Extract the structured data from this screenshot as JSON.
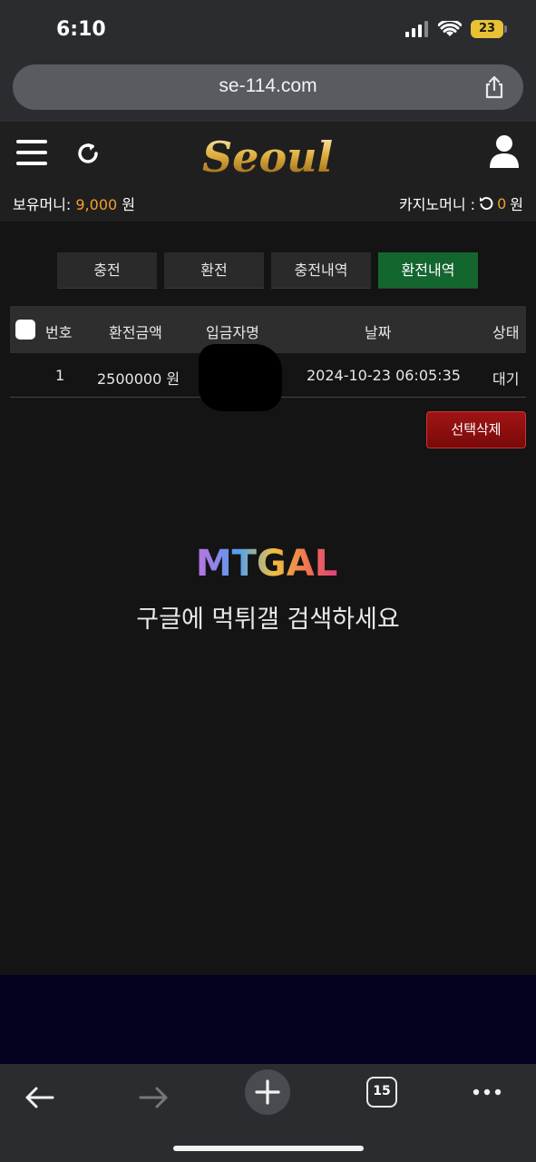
{
  "status": {
    "time": "6:10",
    "battery": "23"
  },
  "browser": {
    "url": "se-114.com",
    "tab_count": "15"
  },
  "header": {
    "logo_text": "Seoul",
    "holding_label": "보유머니:",
    "holding_amount": "9,000",
    "holding_unit": "원",
    "casino_label": "카지노머니 :",
    "casino_amount": "0",
    "casino_unit": "원"
  },
  "tabs": [
    {
      "label": "충전",
      "active": false
    },
    {
      "label": "환전",
      "active": false
    },
    {
      "label": "충전내역",
      "active": false
    },
    {
      "label": "환전내역",
      "active": true
    }
  ],
  "table": {
    "headers": [
      "번호",
      "환전금액",
      "입금자명",
      "날짜",
      "상태"
    ],
    "rows": [
      {
        "no": "1",
        "amount": "2500000 원",
        "depositor": "",
        "date": "2024-10-23 06:05:35",
        "status": "대기"
      }
    ]
  },
  "delete_button": "선택삭제",
  "watermark": {
    "logo_text": "MTGAL",
    "text": "구글에 먹튀갤 검색하세요"
  },
  "colors": {
    "accent_gold": "#f0a030",
    "active_tab": "#14662f",
    "delete_red": "#8f1010"
  }
}
